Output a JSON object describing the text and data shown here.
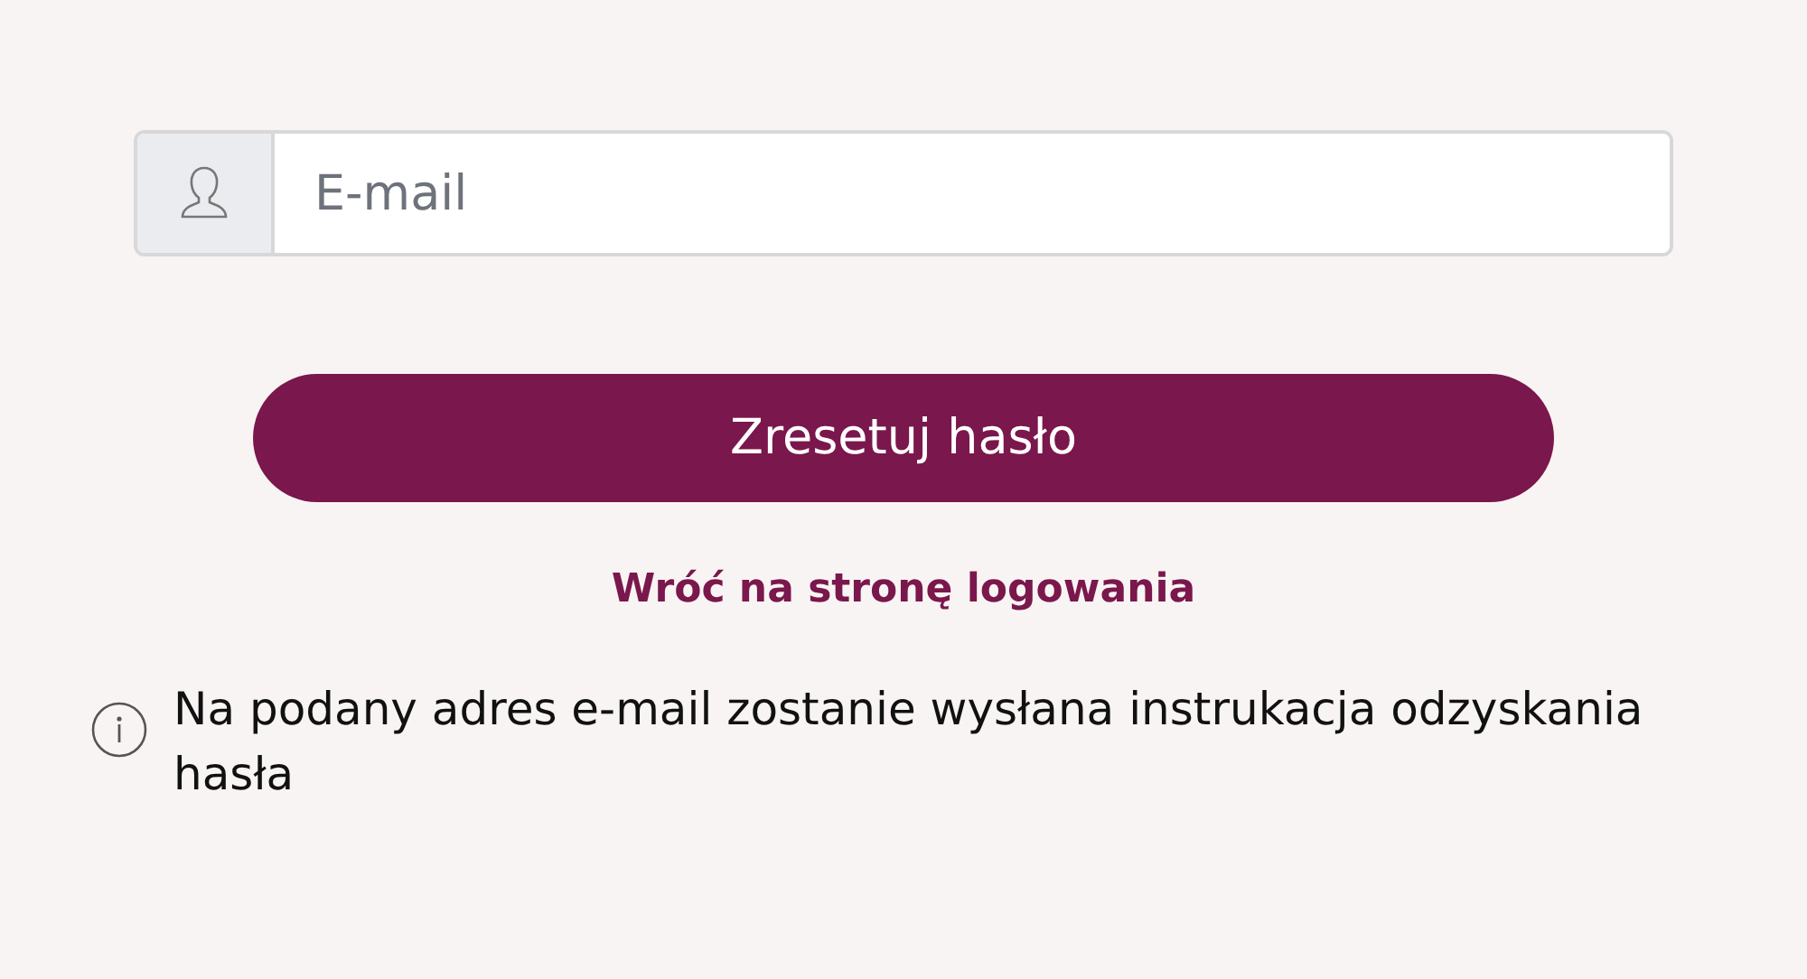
{
  "email_field": {
    "placeholder": "E-mail"
  },
  "reset_button": {
    "label": "Zresetuj hasło"
  },
  "back_link": {
    "label": "Wróć na stronę logowania"
  },
  "info": {
    "text": "Na podany adres e-mail zostanie wysłana instrukacja odzyskania hasła"
  }
}
